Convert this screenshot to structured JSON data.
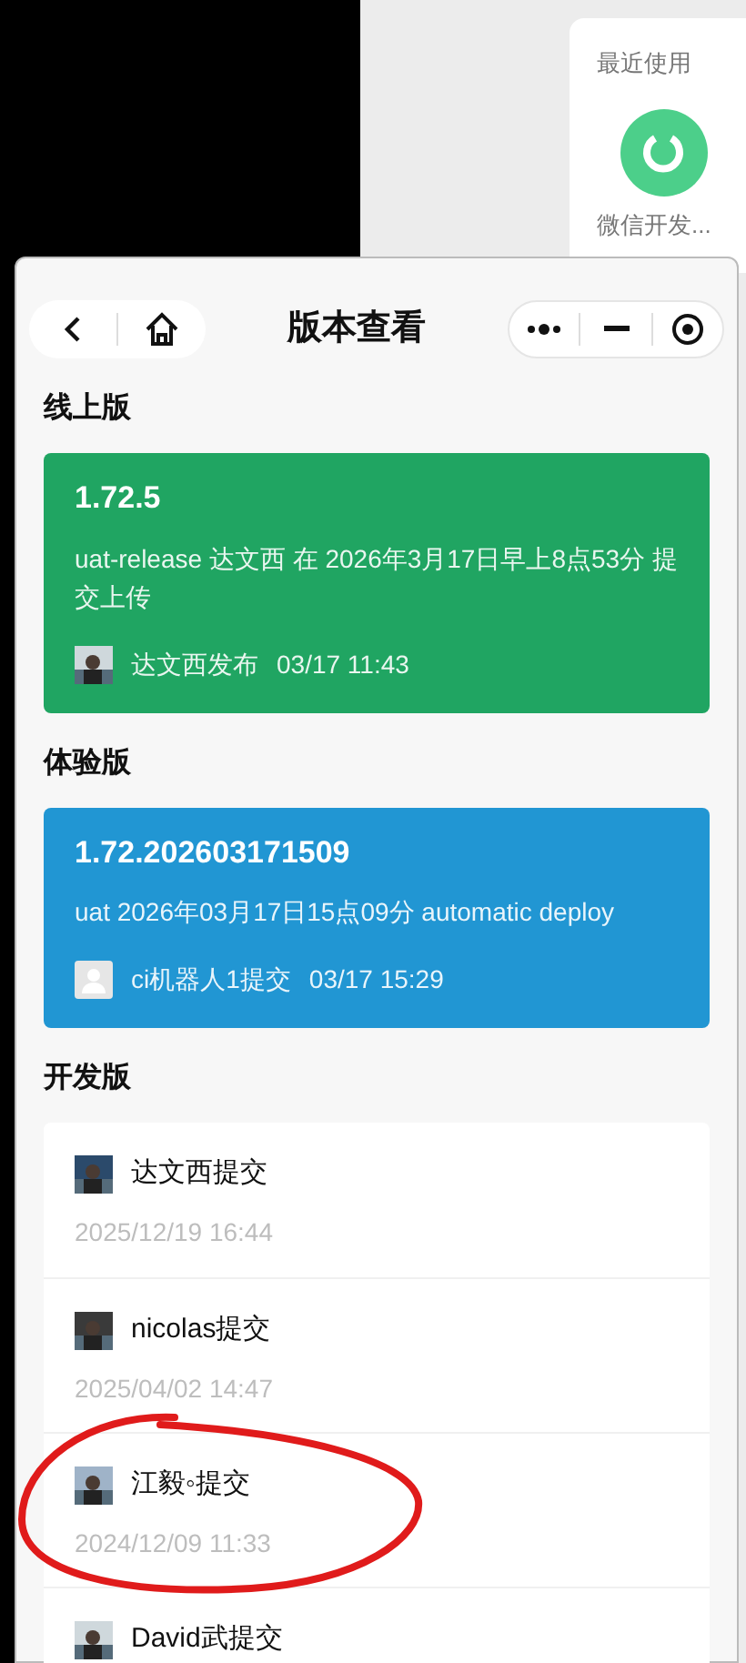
{
  "recent_panel": {
    "title": "最近使用",
    "app_name": "微信开发..."
  },
  "window": {
    "title": "版本查看"
  },
  "sections": [
    {
      "heading": "线上版",
      "kind": "release",
      "color": "#20a562",
      "version": "1.72.5",
      "description": "uat-release 达文西 在 2026年3月17日早上8点53分 提交上传",
      "author": "达文西发布",
      "time": "03/17 11:43"
    },
    {
      "heading": "体验版",
      "kind": "release",
      "color": "#2196d3",
      "version": "1.72.202603171509",
      "description": "uat 2026年03月17日15点09分 automatic deploy",
      "author": "ci机器人1提交",
      "time": "03/17 15:29",
      "avatar": {
        "kind": "placeholder"
      }
    },
    {
      "heading": "开发版",
      "kind": "list",
      "items": [
        {
          "author": "达文西提交",
          "time": "2025/12/19 16:44"
        },
        {
          "author": "nicolas提交",
          "time": "2025/04/02 14:47"
        },
        {
          "author": "江毅◦提交",
          "time": "2024/12/09 11:33",
          "circled": true
        },
        {
          "author": "David武提交",
          "circled": false
        }
      ]
    }
  ]
}
